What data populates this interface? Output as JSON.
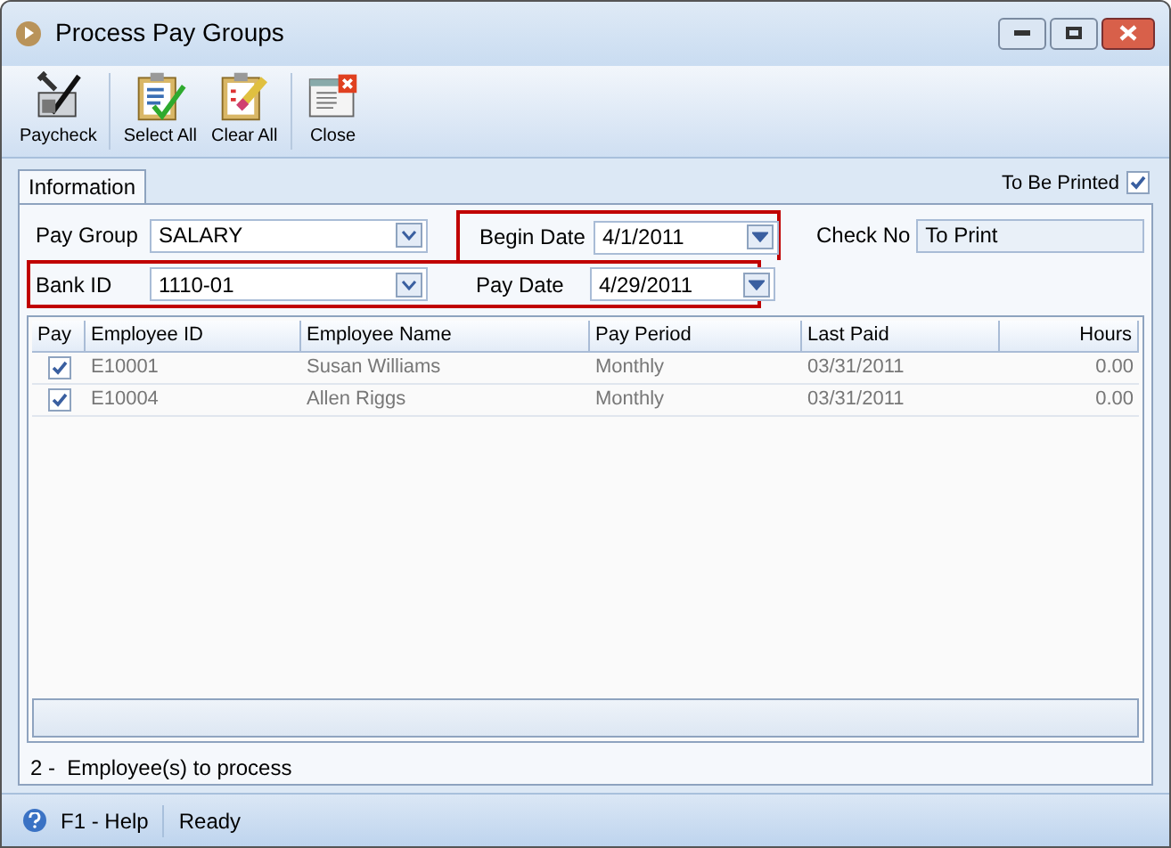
{
  "window": {
    "title": "Process Pay Groups"
  },
  "toolbar": [
    {
      "label": "Paycheck",
      "kind": "paycheck"
    },
    {
      "label": "Select All",
      "kind": "select"
    },
    {
      "label": "Clear All",
      "kind": "clear"
    },
    {
      "label": "Close",
      "kind": "close"
    }
  ],
  "tabs": [
    {
      "label": "Information",
      "selected": true
    }
  ],
  "to_be_printed": {
    "label": "To Be Printed",
    "checked": true
  },
  "fields": {
    "pay_group": {
      "label": "Pay Group",
      "value": "SALARY"
    },
    "begin_date": {
      "label": "Begin Date",
      "value": "4/1/2011"
    },
    "check_no": {
      "label": "Check No",
      "value": "To Print"
    },
    "bank_id": {
      "label": "Bank ID",
      "value": "1110-01"
    },
    "pay_date": {
      "label": "Pay Date",
      "value": "4/29/2011"
    }
  },
  "table": {
    "columns": [
      "Pay",
      "Employee ID",
      "Employee Name",
      "Pay Period",
      "Last Paid",
      "Hours"
    ],
    "rows": [
      {
        "checked": true,
        "cells": [
          "",
          "E10001",
          "Susan Williams",
          "Monthly",
          "03/31/2011",
          "0.00"
        ]
      },
      {
        "checked": true,
        "cells": [
          "",
          "E10004",
          "Allen Riggs",
          "Monthly",
          "03/31/2011",
          "0.00"
        ]
      }
    ]
  },
  "footer": "2 -  Employee(s) to process",
  "status_bar": {
    "help": "F1 - Help",
    "status": "Ready"
  }
}
